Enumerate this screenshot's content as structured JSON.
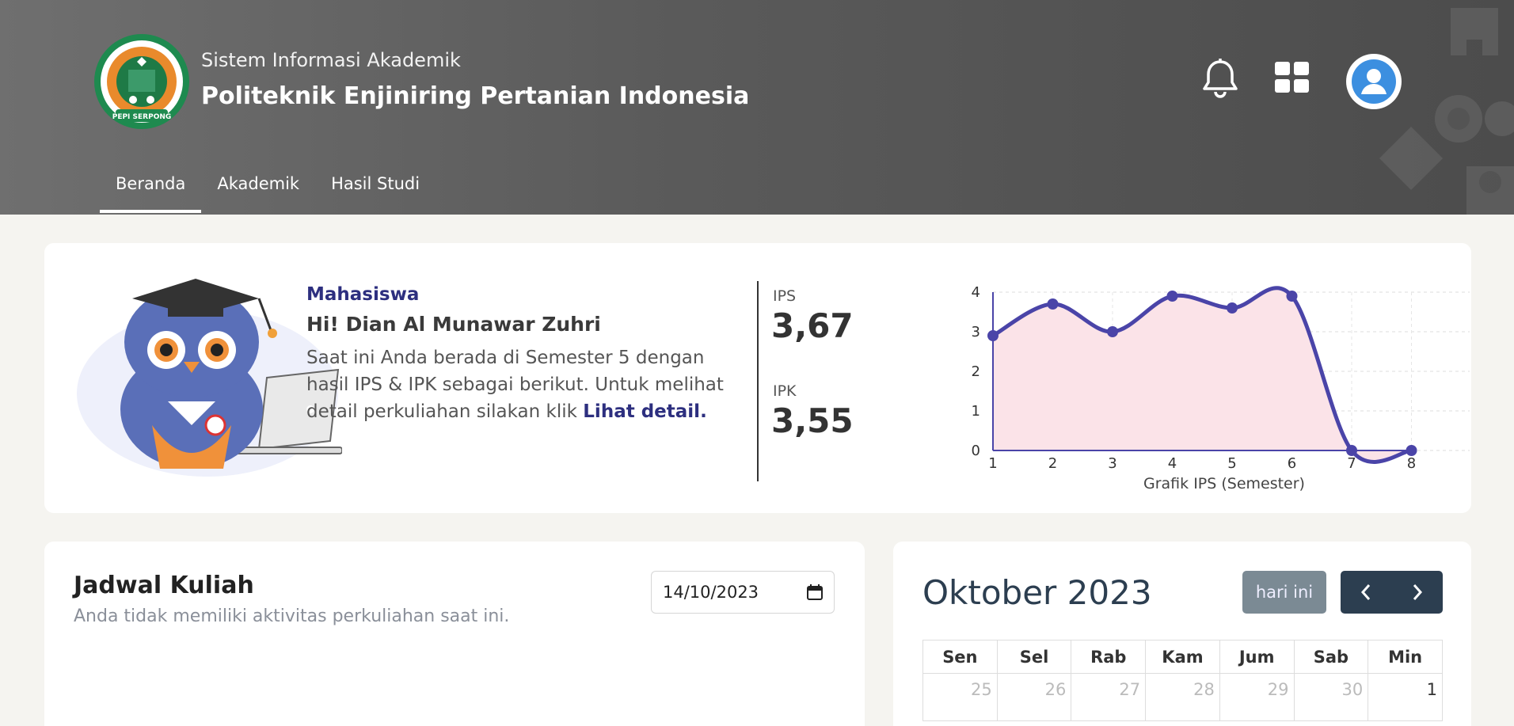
{
  "header": {
    "subtitle": "Sistem Informasi Akademik",
    "title": "Politeknik Enjiniring Pertanian Indonesia",
    "logo_text_top": "POLITEKNIK ENJINIRING PERTANIAN INDONESIA",
    "logo_text_bottom": "PEPI SERPONG"
  },
  "nav": {
    "tabs": [
      {
        "label": "Beranda",
        "active": true
      },
      {
        "label": "Akademik",
        "active": false
      },
      {
        "label": "Hasil Studi",
        "active": false
      }
    ]
  },
  "profile": {
    "role": "Mahasiswa",
    "greeting": "Hi! Dian Al Munawar Zuhri",
    "description": "Saat ini Anda berada di Semester 5 dengan hasil IPS & IPK sebagai berikut. Untuk melihat detail perkuliahan silakan klik ",
    "detail_link": "Lihat detail.",
    "ips_label": "IPS",
    "ips_value": "3,67",
    "ipk_label": "IPK",
    "ipk_value": "3,55"
  },
  "chart_data": {
    "type": "area",
    "x": [
      1,
      2,
      3,
      4,
      5,
      6,
      7,
      8
    ],
    "values": [
      2.9,
      3.7,
      3.0,
      3.9,
      3.6,
      3.9,
      0,
      0
    ],
    "xlabel": "Grafik IPS (Semester)",
    "ylim": [
      0,
      4
    ],
    "yticks": [
      0,
      1,
      2,
      3,
      4
    ],
    "grid": true,
    "line_color": "#4a44a8",
    "fill_color": "#fbe3e8"
  },
  "schedule": {
    "title": "Jadwal Kuliah",
    "subtitle": "Anda tidak memiliki aktivitas perkuliahan saat ini.",
    "date": "14/10/2023"
  },
  "calendar": {
    "title": "Oktober 2023",
    "today_label": "hari ini",
    "weekdays": [
      "Sen",
      "Sel",
      "Rab",
      "Kam",
      "Jum",
      "Sab",
      "Min"
    ],
    "first_row": [
      {
        "day": "25",
        "current": false
      },
      {
        "day": "26",
        "current": false
      },
      {
        "day": "27",
        "current": false
      },
      {
        "day": "28",
        "current": false
      },
      {
        "day": "29",
        "current": false
      },
      {
        "day": "30",
        "current": false
      },
      {
        "day": "1",
        "current": true
      }
    ]
  },
  "colors": {
    "accent": "#2d2f7f",
    "header_bg": "#5a5a5a",
    "calendar_dark": "#2c3e50",
    "today_btn": "#7b8a94"
  }
}
